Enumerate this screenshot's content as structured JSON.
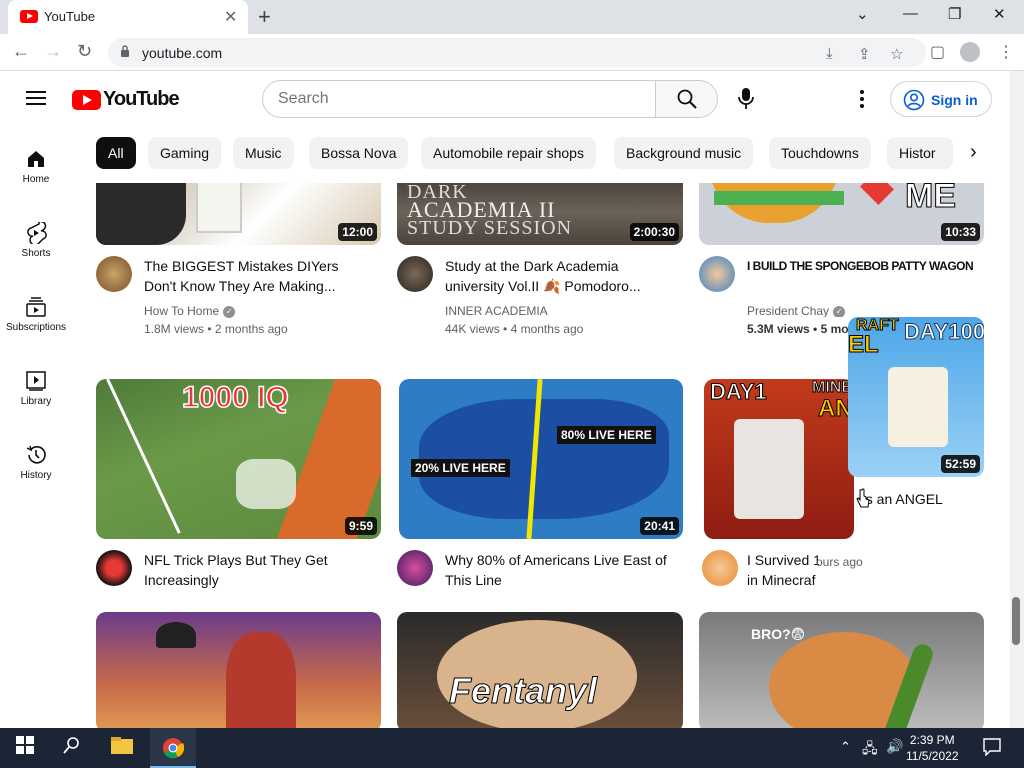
{
  "browser": {
    "tab_title": "YouTube",
    "url": "youtube.com"
  },
  "header": {
    "logo_text": "YouTube",
    "search_placeholder": "Search",
    "signin_label": "Sign in"
  },
  "chips": [
    "All",
    "Gaming",
    "Music",
    "Bossa Nova",
    "Automobile repair shops",
    "Background music",
    "Touchdowns",
    "Histor"
  ],
  "sidebar": [
    {
      "label": "Home",
      "icon": "home-icon"
    },
    {
      "label": "Shorts",
      "icon": "shorts-icon"
    },
    {
      "label": "Subscriptions",
      "icon": "subscriptions-icon"
    },
    {
      "label": "Library",
      "icon": "library-icon"
    },
    {
      "label": "History",
      "icon": "history-icon"
    }
  ],
  "videos": [
    {
      "title": "The BIGGEST Mistakes DIYers Don't Know They Are Making...",
      "channel": "How To Home",
      "verified": true,
      "views": "1.8M views",
      "age": "2 months ago",
      "duration": "12:00"
    },
    {
      "title": "Study at the Dark Academia university Vol.II 🍂 Pomodoro...",
      "channel": "INNER ACADEMIA",
      "verified": false,
      "views": "44K views",
      "age": "4 months ago",
      "duration": "2:00:30",
      "thumb_text_1": "DARK",
      "thumb_text_2": "ACADEMIA II",
      "thumb_text_3": "STUDY SESSION"
    },
    {
      "title": "I BUILD THE SPONGEBOB PATTY WAGON",
      "channel": "President Chay",
      "verified": true,
      "views": "5.3M views",
      "age": "5 mo",
      "duration": "10:33",
      "thumb_text": "ME"
    },
    {
      "title": "NFL Trick Plays But They Get Increasingly",
      "channel": "",
      "views": "",
      "age": "",
      "duration": "9:59",
      "thumb_text": "1000 IQ"
    },
    {
      "title": "Why 80% of Americans Live East of This Line",
      "channel": "",
      "views": "",
      "age": "",
      "duration": "20:41",
      "thumb_text_1": "20% LIVE HERE",
      "thumb_text_2": "80% LIVE HERE"
    },
    {
      "title": "I Survived 100 Days as an ANGEL in Minecraft",
      "title_visible_1": "I Survived 100",
      "title_visible_2": "in Minecraf",
      "fragment_1": "as an ANGEL",
      "fragment_2": "ours ago",
      "duration": "52:59",
      "thumb_text_1": "DAY1",
      "thumb_text_2": "MINECR",
      "thumb_text_3": "ANGE",
      "thumb_text_4": "DAY100",
      "thumb_text_5": "RAFT",
      "thumb_text_6": "EL"
    },
    {
      "title": "",
      "duration": ""
    },
    {
      "title": "",
      "duration": "",
      "thumb_text": "Fentanyl"
    },
    {
      "title": "",
      "duration": "",
      "thumb_text": "BRO?😨"
    }
  ],
  "taskbar": {
    "time": "2:39 PM",
    "date": "11/5/2022"
  }
}
